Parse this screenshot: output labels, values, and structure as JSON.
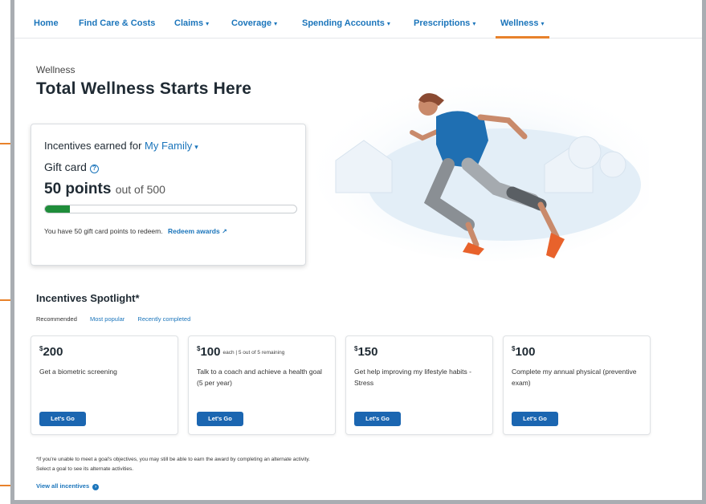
{
  "nav": {
    "items": [
      {
        "label": "Home",
        "caret": false
      },
      {
        "label": "Find Care & Costs",
        "caret": false
      },
      {
        "label": "Claims",
        "caret": true
      },
      {
        "label": "Coverage",
        "caret": true
      },
      {
        "label": "Spending Accounts",
        "caret": true
      },
      {
        "label": "Prescriptions",
        "caret": true
      },
      {
        "label": "Wellness",
        "caret": true,
        "active": true
      }
    ]
  },
  "page": {
    "breadcrumb": "Wellness",
    "title": "Total Wellness Starts Here"
  },
  "incentives_card": {
    "earned_label": "Incentives earned for",
    "family_select": "My Family",
    "reward_type": "Gift card",
    "points_earned": "50 points",
    "points_total": "out of 500",
    "progress_fraction": 0.1,
    "redeem_text": "You have 50 gift card points to redeem.",
    "redeem_link": "Redeem awards"
  },
  "spotlight": {
    "title": "Incentives Spotlight*",
    "tabs": [
      "Recommended",
      "Most popular",
      "Recently completed"
    ],
    "tiles": [
      {
        "amount": "200",
        "note": "",
        "description": "Get a biometric screening",
        "button": "Let's Go"
      },
      {
        "amount": "100",
        "note": "each | 5 out of 5 remaining",
        "description": "Talk to a coach and achieve a health goal (5 per year)",
        "button": "Let's Go"
      },
      {
        "amount": "150",
        "note": "",
        "description": "Get help improving my lifestyle habits - Stress",
        "button": "Let's Go"
      },
      {
        "amount": "100",
        "note": "",
        "description": "Complete my annual physical (preventive exam)",
        "button": "Let's Go"
      }
    ],
    "currency_symbol": "$"
  },
  "footnote": {
    "line1": "*If you're unable to meet a goal's objectives, you may still be able to earn the award by completing an alternate activity.",
    "line2": "Select a goal to see its alternate activities.",
    "view_all": "View all incentives"
  },
  "colors": {
    "accent_orange": "#e8822b",
    "link_blue": "#1b75bb",
    "button_blue": "#1b66b1",
    "progress_green": "#1f8d3a"
  }
}
